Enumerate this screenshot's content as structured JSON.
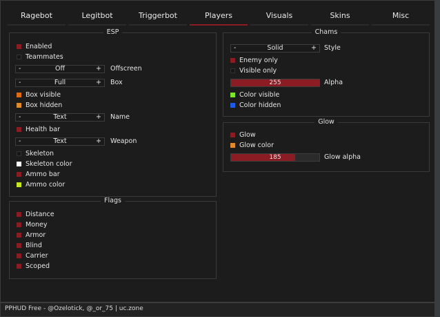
{
  "tabs": [
    {
      "label": "Ragebot"
    },
    {
      "label": "Legitbot"
    },
    {
      "label": "Triggerbot"
    },
    {
      "label": "Players"
    },
    {
      "label": "Visuals"
    },
    {
      "label": "Skins"
    },
    {
      "label": "Misc"
    }
  ],
  "active_tab": "Players",
  "colors": {
    "accent": "#8b1c24",
    "unchecked": "#1a1a1a",
    "orange": "#e06a12",
    "orange2": "#e08a2a",
    "white": "#ffffff",
    "lime": "#c8e61e",
    "green": "#7ee62a",
    "blue": "#1e5ae6"
  },
  "esp": {
    "title": "ESP",
    "enabled": "Enabled",
    "teammates": "Teammates",
    "offscreen": {
      "value": "Off",
      "label": "Offscreen"
    },
    "box": {
      "value": "Full",
      "label": "Box"
    },
    "box_visible": "Box visible",
    "box_hidden": "Box hidden",
    "name": {
      "value": "Text",
      "label": "Name"
    },
    "health_bar": "Health bar",
    "weapon": {
      "value": "Text",
      "label": "Weapon"
    },
    "skeleton": "Skeleton",
    "skeleton_color": "Skeleton color",
    "ammo_bar": "Ammo bar",
    "ammo_color": "Ammo color",
    "minus": "-",
    "plus": "+"
  },
  "flags": {
    "title": "Flags",
    "items": [
      {
        "label": "Distance"
      },
      {
        "label": "Money"
      },
      {
        "label": "Armor"
      },
      {
        "label": "Blind"
      },
      {
        "label": "Carrier"
      },
      {
        "label": "Scoped"
      }
    ]
  },
  "chams": {
    "title": "Chams",
    "style": {
      "value": "Solid",
      "label": "Style"
    },
    "enemy_only": "Enemy only",
    "visible_only": "Visible only",
    "alpha": {
      "value": "255",
      "label": "Alpha",
      "fraction": 1.0
    },
    "color_visible": "Color visible",
    "color_hidden": "Color hidden"
  },
  "glow": {
    "title": "Glow",
    "glow": "Glow",
    "glow_color": "Glow color",
    "glow_alpha": {
      "value": "185",
      "label": "Glow alpha",
      "fraction": 0.725
    }
  },
  "footer": "PPHUD Free - @Ozelotick, @_or_75 | uc.zone"
}
